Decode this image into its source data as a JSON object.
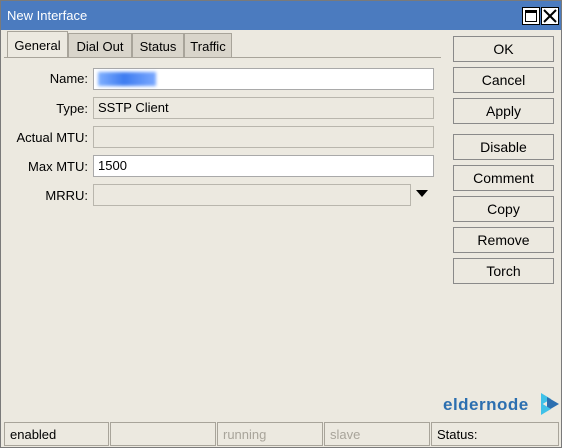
{
  "window": {
    "title": "New Interface"
  },
  "tabs": [
    {
      "label": "General",
      "active": true
    },
    {
      "label": "Dial Out",
      "active": false
    },
    {
      "label": "Status",
      "active": false
    },
    {
      "label": "Traffic",
      "active": false
    }
  ],
  "form": {
    "name": {
      "label": "Name:",
      "value": "redacted"
    },
    "type": {
      "label": "Type:",
      "value": "SSTP Client"
    },
    "actual_mtu": {
      "label": "Actual MTU:",
      "value": ""
    },
    "max_mtu": {
      "label": "Max MTU:",
      "value": "1500"
    },
    "mrru": {
      "label": "MRRU:",
      "value": ""
    }
  },
  "buttons": {
    "ok": "OK",
    "cancel": "Cancel",
    "apply": "Apply",
    "disable": "Disable",
    "comment": "Comment",
    "copy": "Copy",
    "remove": "Remove",
    "torch": "Torch"
  },
  "logo": {
    "text": "eldernode",
    "primary_color": "#2c6fb0",
    "accent_color": "#3fc1e8"
  },
  "statusbar": {
    "state": "enabled",
    "blank": "",
    "running": "running",
    "slave": "slave",
    "status_label": "Status:"
  },
  "colors": {
    "titlebar": "#4b7bbf",
    "window_bg": "#ece9e0"
  },
  "icons": {
    "maximize": "maximize-icon",
    "close": "close-icon",
    "dropdown": "dropdown-arrow-icon"
  }
}
